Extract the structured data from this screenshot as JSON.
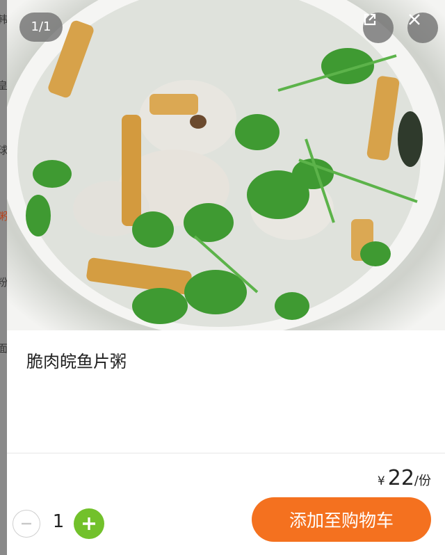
{
  "background_partial": [
    "韩",
    "皇",
    "球",
    "粥",
    "粉",
    "面"
  ],
  "photo": {
    "counter": "1/1",
    "open_icon": "external-link-icon",
    "close_icon": "close-icon"
  },
  "product": {
    "name": "脆肉皖鱼片粥",
    "currency": "¥",
    "price": "22",
    "unit": "/份"
  },
  "quantity": {
    "value": "1",
    "minus_icon": "minus-icon",
    "plus_icon": "plus-icon"
  },
  "actions": {
    "add_to_cart": "添加至购物车"
  },
  "colors": {
    "accent": "#f4711f",
    "plus": "#72c12b"
  }
}
